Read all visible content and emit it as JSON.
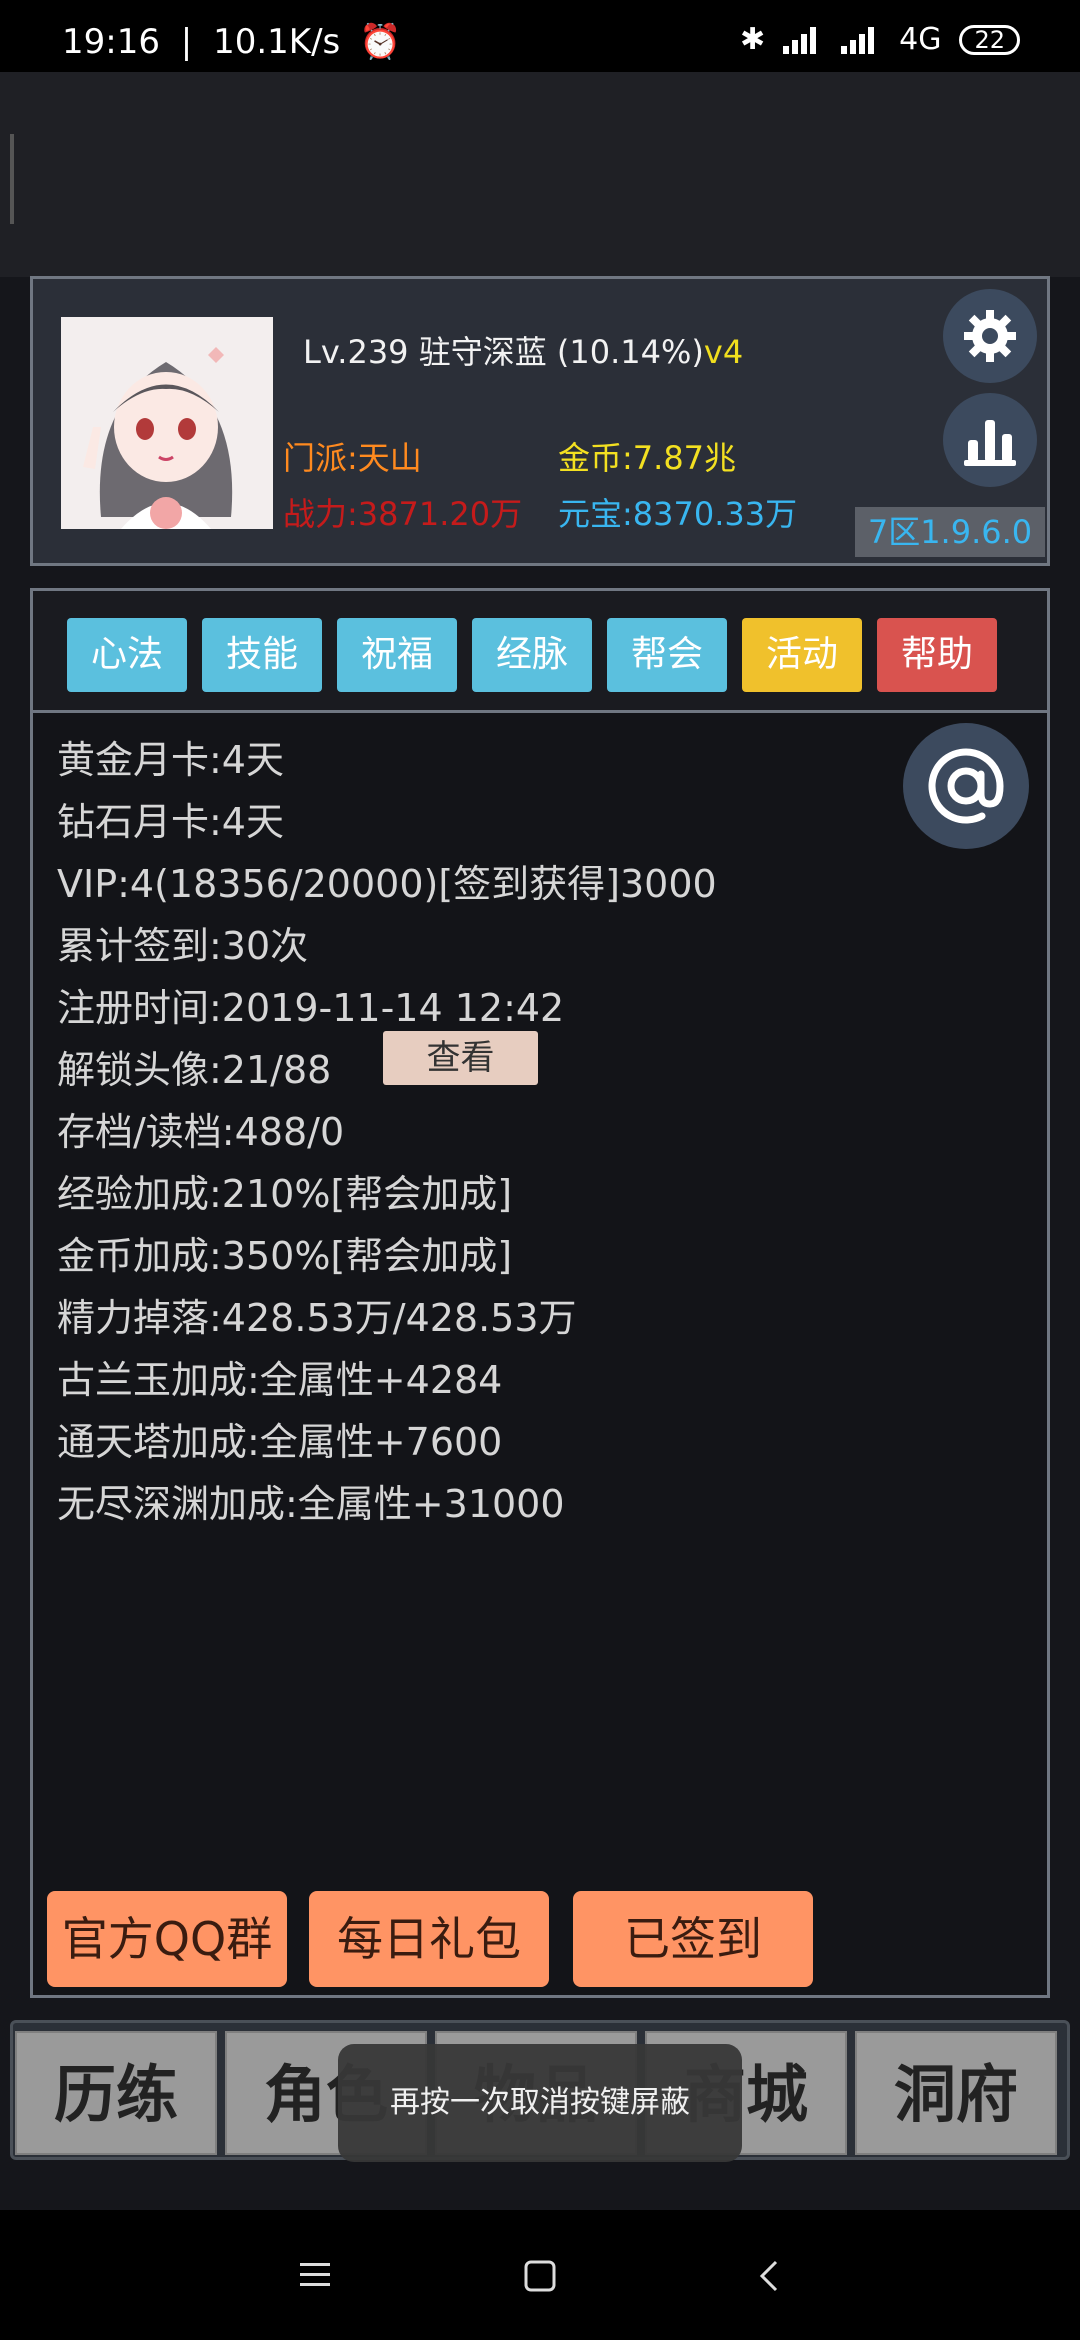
{
  "status_bar": {
    "time": "19:16",
    "net_speed": "10.1K/s",
    "network": "4G",
    "battery": "22"
  },
  "profile": {
    "level_title": "Lv.239 驻守深蓝 (10.14%)",
    "vip_tag": "v4",
    "faction": "门派:天山",
    "gold": "金币:7.87兆",
    "power": "战力:3871.20万",
    "ingot": "元宝:8370.33万",
    "version": "7区1.9.6.0"
  },
  "tabs": [
    {
      "label": "心法",
      "color": "#5bc0de"
    },
    {
      "label": "技能",
      "color": "#5bc0de"
    },
    {
      "label": "祝福",
      "color": "#5bc0de"
    },
    {
      "label": "经脉",
      "color": "#5bc0de"
    },
    {
      "label": "帮会",
      "color": "#5bc0de"
    },
    {
      "label": "活动",
      "color": "#f0c12c"
    },
    {
      "label": "帮助",
      "color": "#d9534f"
    }
  ],
  "info": {
    "lines": [
      "黄金月卡:4天",
      "钻石月卡:4天",
      "VIP:4(18356/20000)[签到获得]3000",
      "累计签到:30次",
      "注册时间:2019-11-14 12:42",
      "解锁头像:21/88",
      "存档/读档:488/0",
      "经验加成:210%[帮会加成]",
      "金币加成:350%[帮会加成]",
      "精力掉落:428.53万/428.53万",
      "古兰玉加成:全属性+4284",
      "通天塔加成:全属性+7600",
      "无尽深渊加成:全属性+31000"
    ],
    "view_button": "查看"
  },
  "actions": {
    "qq_group": "官方QQ群",
    "daily_gift": "每日礼包",
    "signed_in": "已签到"
  },
  "bottom_nav": [
    "历练",
    "角色",
    "物品",
    "商城",
    "洞府"
  ],
  "toast": "再按一次取消按键屏蔽",
  "icons": {
    "settings": "gear-icon",
    "stats": "bar-chart-icon",
    "mention": "at-icon"
  }
}
